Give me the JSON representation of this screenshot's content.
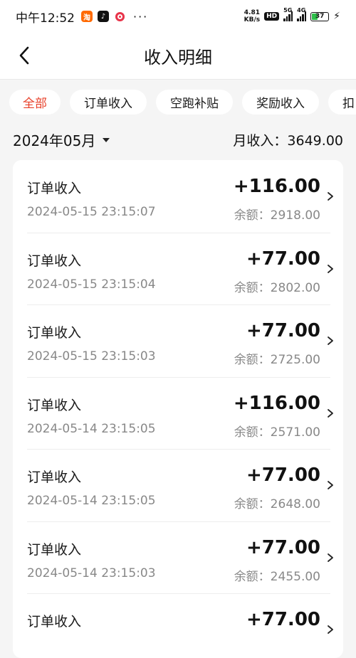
{
  "status_bar": {
    "time": "中午12:52",
    "app_badge_1": "淘",
    "app_badge_2": "♪",
    "more": "···",
    "speed_value": "4.81",
    "speed_unit": "KB/s",
    "hd_label": "HD",
    "sig1_label": "5G",
    "sig2_label": "4G",
    "battery_pct": "37",
    "battery_level": 0.37,
    "bolt": "⚡"
  },
  "nav": {
    "title": "收入明细"
  },
  "tabs": [
    {
      "label": "全部",
      "active": true
    },
    {
      "label": "订单收入",
      "active": false
    },
    {
      "label": "空跑补贴",
      "active": false
    },
    {
      "label": "奖励收入",
      "active": false
    },
    {
      "label": "扣",
      "active": false
    }
  ],
  "month": {
    "selected": "2024年05月",
    "total_label": "月收入：3649.00"
  },
  "records": [
    {
      "title": "订单收入",
      "time": "2024-05-15 23:15:07",
      "amount": "+116.00",
      "balance": "余额：2918.00"
    },
    {
      "title": "订单收入",
      "time": "2024-05-15 23:15:04",
      "amount": "+77.00",
      "balance": "余额：2802.00"
    },
    {
      "title": "订单收入",
      "time": "2024-05-15 23:15:03",
      "amount": "+77.00",
      "balance": "余额：2725.00"
    },
    {
      "title": "订单收入",
      "time": "2024-05-14 23:15:05",
      "amount": "+116.00",
      "balance": "余额：2571.00"
    },
    {
      "title": "订单收入",
      "time": "2024-05-14 23:15:05",
      "amount": "+77.00",
      "balance": "余额：2648.00"
    },
    {
      "title": "订单收入",
      "time": "2024-05-14 23:15:03",
      "amount": "+77.00",
      "balance": "余额：2455.00"
    },
    {
      "title": "订单收入",
      "time": "",
      "amount": "+77.00",
      "balance": ""
    }
  ],
  "colors": {
    "accent": "#e8402a",
    "background": "#f5f5f5",
    "muted_text": "#888888"
  }
}
